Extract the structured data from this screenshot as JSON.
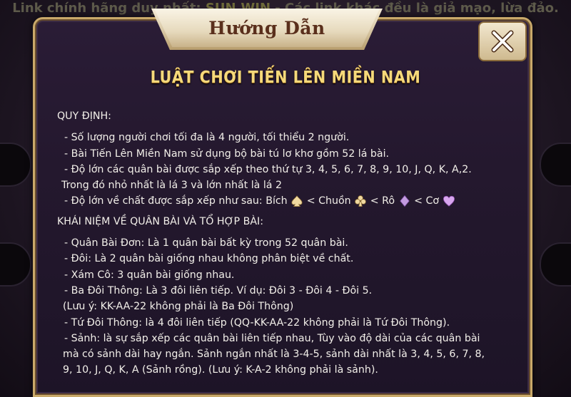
{
  "background": {
    "banner_prefix": "Link chính hãng duy nhất: ",
    "banner_link": "SUN.WIN",
    "banner_suffix": " - Các link khác đều là giả mạo, lừa đảo."
  },
  "dialog": {
    "title": "Hướng Dẫn",
    "heading": "LUẬT CHƠI TIẾN LÊN MIỀN NAM",
    "close_icon": "close-icon",
    "accent_color": "#f6d97a",
    "border_color": "#c9a96a",
    "rules": {
      "section1_title": "QUY ĐỊNH:",
      "r1": "- Số lượng người chơi tối đa là 4 người, tối thiểu 2 người.",
      "r2": "- Bài Tiến Lên Miền Nam sử dụng bộ bài tú lơ khơ gồm 52 lá bài.",
      "r3a": "- Độ lớn các quân bài được sắp xếp theo thứ tự 3, 4, 5, 6, 7, 8, 9, 10, J, Q, K, A,2.",
      "r3b": "Trong đó nhỏ nhất là lá 3 và lớn nhất là lá 2",
      "r4_prefix": "- Độ lớn về chất được sắp xếp như sau: Bích",
      "r4_p1": "< Chuồn",
      "r4_p2": "< Rô",
      "r4_p3": "< Cơ",
      "section2_title": "KHÁI NIỆM VỀ QUÂN BÀI VÀ TỔ HỢP BÀI:",
      "c1": "- Quân Bài Đơn: Là 1 quân bài bất kỳ trong 52 quân bài.",
      "c2": "- Đôi: Là 2 quân bài giống nhau không phân biệt về chất.",
      "c3": "- Xám Cô: 3 quân bài giống nhau.",
      "c4": "- Ba Đôi Thông: Là 3 đôi liên tiếp. Ví dụ: Đôi 3 - Đôi 4 - Đôi 5.",
      "c4_note": "(Lưu ý: KK-AA-22 không phải là Ba Đôi Thông)",
      "c5": "- Tứ Đôi Thông: là 4 đôi liên tiếp (QQ-KK-AA-22 không phải là Tứ Đôi Thông).",
      "c6a": "- Sảnh: là sự sắp xếp các quân bài liên tiếp nhau, Tùy vào độ dài của các quân bài",
      "c6b": "mà có sảnh dài hay ngắn. Sảnh ngắn nhất là 3-4-5, sảnh dài nhất là 3, 4, 5, 6, 7, 8,",
      "c6c": "9, 10, J, Q, K, A (Sảnh rồng). (Lưu ý: K-A-2 không phải là sảnh)."
    },
    "suit_icons": [
      "spade-icon",
      "club-icon",
      "diamond-icon",
      "heart-icon"
    ]
  }
}
